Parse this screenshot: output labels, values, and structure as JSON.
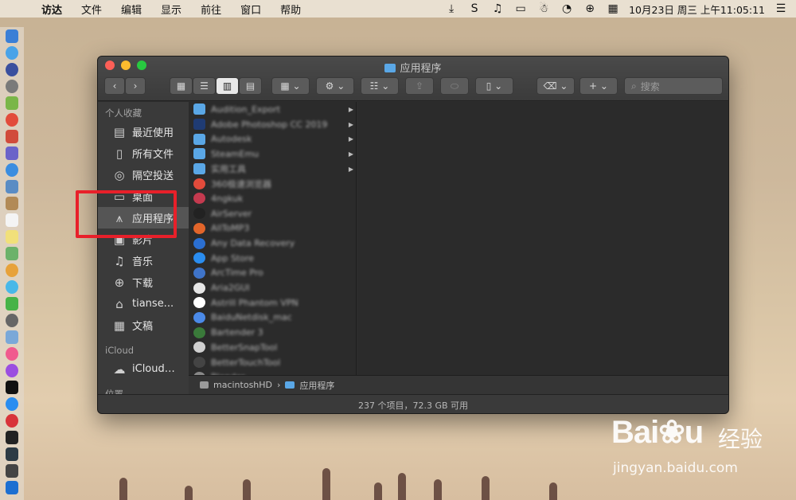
{
  "menubar": {
    "app": "访达",
    "items": [
      "文件",
      "编辑",
      "显示",
      "前往",
      "窗口",
      "帮助"
    ],
    "clock": "10月23日 周三 上午11:05:11"
  },
  "window": {
    "title": "应用程序",
    "search_placeholder": "搜索"
  },
  "sidebar": {
    "favorites_header": "个人收藏",
    "favorites": [
      {
        "label": "最近使用",
        "icon": "recent-icon"
      },
      {
        "label": "所有文件",
        "icon": "all-files-icon"
      },
      {
        "label": "隔空投送",
        "icon": "airdrop-icon"
      },
      {
        "label": "桌面",
        "icon": "desktop-icon"
      },
      {
        "label": "应用程序",
        "icon": "applications-icon",
        "selected": true
      },
      {
        "label": "影片",
        "icon": "movies-icon"
      },
      {
        "label": "音乐",
        "icon": "music-icon"
      },
      {
        "label": "下载",
        "icon": "downloads-icon"
      },
      {
        "label": "tianse...",
        "icon": "home-icon"
      },
      {
        "label": "文稿",
        "icon": "documents-icon"
      }
    ],
    "icloud_header": "iCloud",
    "icloud": [
      {
        "label": "iCloud…",
        "icon": "cloud-icon"
      }
    ],
    "locations_header": "位置"
  },
  "files": [
    {
      "name": "Audition_Export",
      "color": "#5aa7e6",
      "folder": true
    },
    {
      "name": "Adobe Photoshop CC 2019",
      "color": "#1f3b73",
      "folder": true
    },
    {
      "name": "Autodesk",
      "color": "#5aa7e6",
      "folder": true
    },
    {
      "name": "SteamEmu",
      "color": "#5aa7e6",
      "folder": true
    },
    {
      "name": "实用工具",
      "color": "#5aa7e6",
      "folder": true
    },
    {
      "name": "360极速浏览器",
      "color": "#e24b3b",
      "folder": false
    },
    {
      "name": "4ngkuk",
      "color": "#c43a4f",
      "folder": false
    },
    {
      "name": "AirServer",
      "color": "#222222",
      "folder": false
    },
    {
      "name": "AllToMP3",
      "color": "#e2652a",
      "folder": false
    },
    {
      "name": "Any Data Recovery",
      "color": "#2b6fd1",
      "folder": false
    },
    {
      "name": "App Store",
      "color": "#2a8df0",
      "folder": false
    },
    {
      "name": "ArcTime Pro",
      "color": "#3f74c9",
      "folder": false
    },
    {
      "name": "Aria2GUI",
      "color": "#e6e6e6",
      "folder": false
    },
    {
      "name": "Astrill Phantom VPN",
      "color": "#ffffff",
      "folder": false
    },
    {
      "name": "BaiduNetdisk_mac",
      "color": "#4b8ae8",
      "folder": false
    },
    {
      "name": "Bartender 3",
      "color": "#3a7a3a",
      "folder": false
    },
    {
      "name": "BetterSnapTool",
      "color": "#cfcfcf",
      "folder": false
    },
    {
      "name": "BetterTouchTool",
      "color": "#444444",
      "folder": false
    },
    {
      "name": "Blender",
      "color": "#888888",
      "folder": false
    }
  ],
  "pathbar": {
    "disk": "macintoshHD",
    "separator": "›",
    "folder": "应用程序"
  },
  "status": "237 个项目，72.3 GB 可用",
  "watermark": {
    "logo": "Bai❀u",
    "cn": "经验",
    "url": "jingyan.baidu.com"
  }
}
